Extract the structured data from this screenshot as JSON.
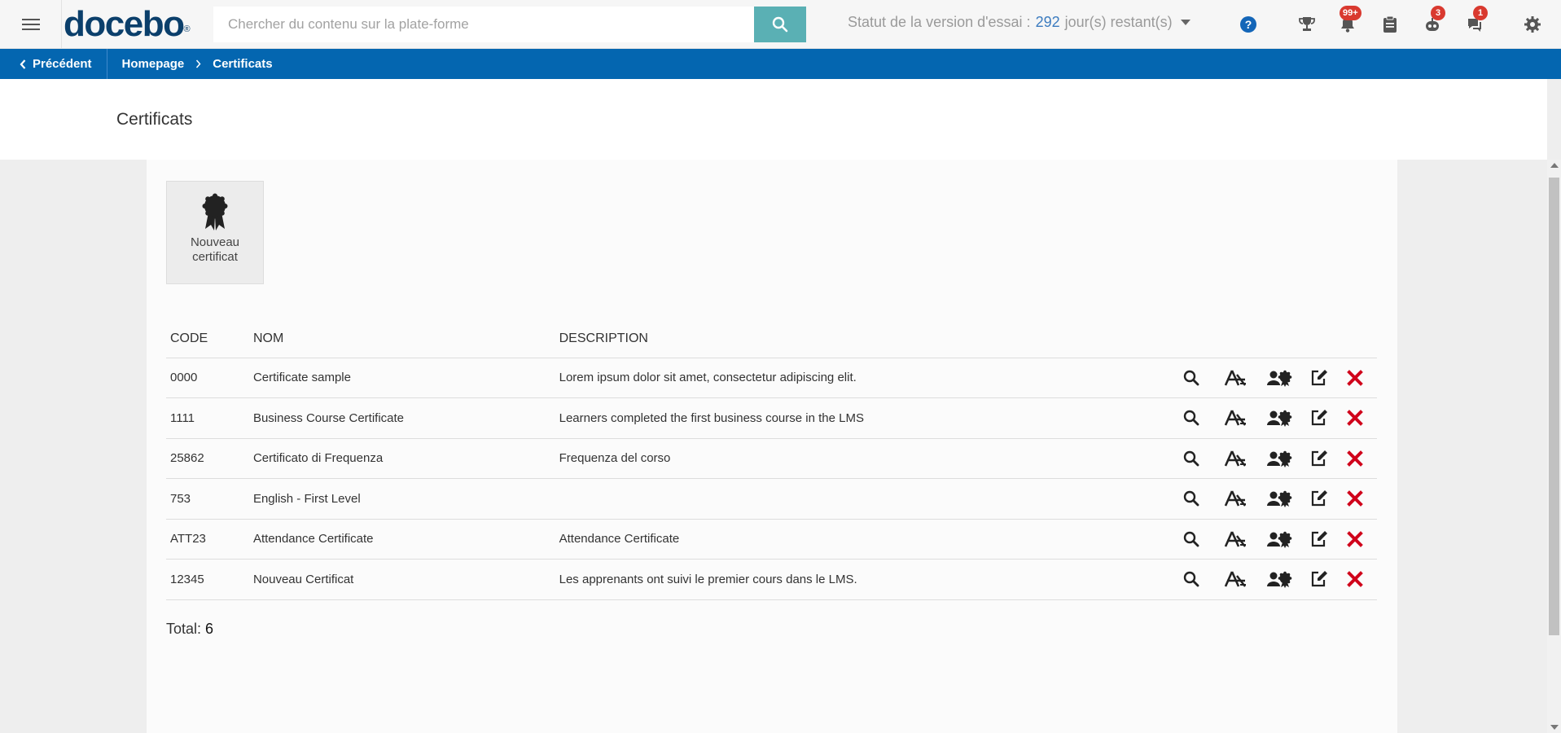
{
  "topbar": {
    "logo": "docebo",
    "logo_mark": "®",
    "search_placeholder": "Chercher du contenu sur la plate-forme",
    "trial_prefix": "Statut de la version d'essai :",
    "trial_days": "292",
    "trial_suffix": "jour(s) restant(s)",
    "badges": {
      "notifications": "99+",
      "messages_bot": "3",
      "chat": "1"
    }
  },
  "breadcrumb": {
    "back_label": "Précédent",
    "items": [
      "Homepage",
      "Certificats"
    ]
  },
  "page": {
    "title": "Certificats"
  },
  "new_certificate": {
    "label": "Nouveau certificat"
  },
  "table": {
    "headers": {
      "code": "CODE",
      "name": "NOM",
      "description": "DESCRIPTION"
    },
    "rows": [
      {
        "code": "0000",
        "name": "Certificate sample",
        "description": "Lorem ipsum dolor sit amet, consectetur adipiscing elit."
      },
      {
        "code": "1111",
        "name": "Business Course Certificate",
        "description": "Learners completed the first business course in the LMS"
      },
      {
        "code": "25862",
        "name": "Certificato di Frequenza",
        "description": "Frequenza del corso"
      },
      {
        "code": "753",
        "name": "English - First Level",
        "description": ""
      },
      {
        "code": "ATT23",
        "name": "Attendance Certificate",
        "description": "Attendance Certificate"
      },
      {
        "code": "12345",
        "name": "Nouveau Certificat",
        "description": "Les apprenants ont suivi le premier cours dans le LMS."
      }
    ]
  },
  "footer": {
    "total_label": "Total:",
    "total_value": "6"
  },
  "colors": {
    "brand": "#0b3f6b",
    "breadcrumb_bg": "#0466b0",
    "search_button": "#5ab0b4",
    "badge": "#d9392f",
    "delete": "#d0021b"
  }
}
